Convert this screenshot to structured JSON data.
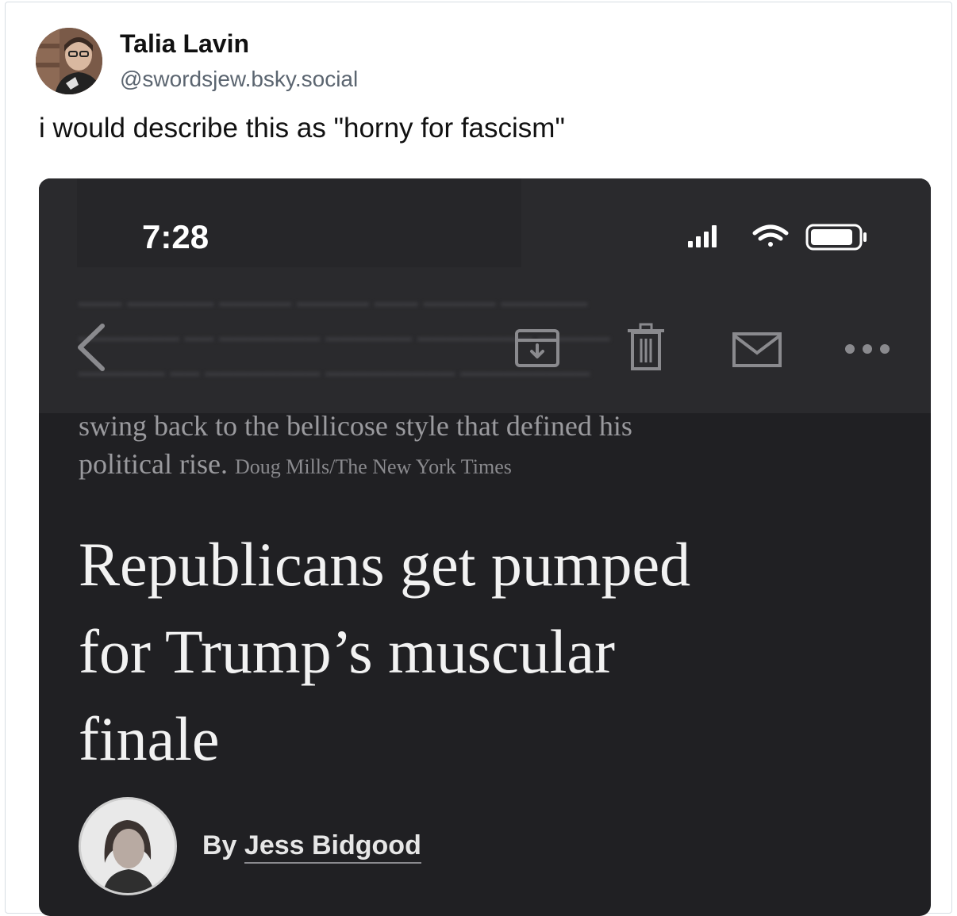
{
  "post": {
    "display_name": "Talia Lavin",
    "handle": "@swordsjew.bsky.social",
    "text": "i would describe this as \"horny for fascism\"",
    "avatar_icon": "avatar"
  },
  "embedded_screenshot": {
    "status_bar": {
      "time": "7:28",
      "icons": [
        "signal-icon",
        "wifi-icon",
        "battery-icon"
      ]
    },
    "toolbar": {
      "icons": [
        "back-chevron-icon",
        "archive-icon",
        "trash-icon",
        "mail-icon",
        "more-icon"
      ]
    },
    "article": {
      "caption_lines": [
        "swing back to the bellicose style that defined his",
        "political rise."
      ],
      "photo_credit": "Doug Mills/The New York Times",
      "headline_lines": [
        "Republicans get pumped",
        "for Trump’s muscular",
        "finale"
      ],
      "byline_prefix": "By",
      "author": "Jess Bidgood"
    },
    "colors": {
      "background": "#202023",
      "toolbar": "#2a2a2d",
      "headline": "#f2f2f2",
      "caption": "#9a9a9e"
    }
  }
}
